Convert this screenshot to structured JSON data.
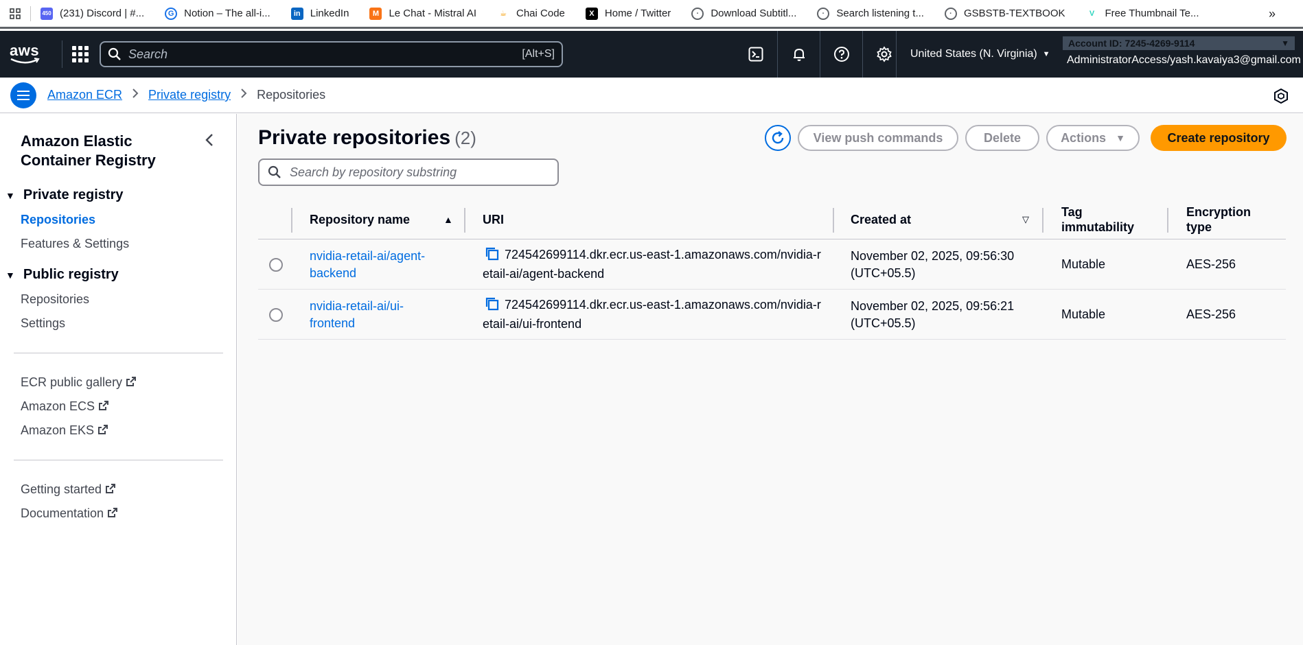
{
  "bookmarks": [
    {
      "label": "(231) Discord | #...",
      "color": "#5865f2",
      "glyph": "450"
    },
    {
      "label": "Notion – The all-i...",
      "color": "#1a73e8",
      "glyph": "G"
    },
    {
      "label": "LinkedIn",
      "color": "#0a66c2",
      "glyph": "in"
    },
    {
      "label": "Le Chat - Mistral AI",
      "color": "#f97316",
      "glyph": "M"
    },
    {
      "label": "Chai Code",
      "color": "#f59e0b",
      "glyph": "☕"
    },
    {
      "label": "Home / Twitter",
      "color": "#000000",
      "glyph": "X"
    },
    {
      "label": "Download Subtitl...",
      "color": "#5f6368",
      "glyph": "◎"
    },
    {
      "label": "Search listening t...",
      "color": "#5f6368",
      "glyph": "◎"
    },
    {
      "label": "GSBSTB-TEXTBOOK",
      "color": "#5f6368",
      "glyph": "◎"
    },
    {
      "label": "Free Thumbnail Te...",
      "color": "#2dd4bf",
      "glyph": "V"
    }
  ],
  "bookmarks_more": "»",
  "topnav": {
    "logo": "aws",
    "search_placeholder": "Search",
    "search_shortcut": "[Alt+S]",
    "region": "United States (N. Virginia)",
    "account_id": "Account ID: 7245-4269-9114",
    "account_user": "AdministratorAccess/yash.kavaiya3@gmail.com"
  },
  "breadcrumb": {
    "items": [
      "Amazon ECR",
      "Private registry"
    ],
    "current": "Repositories"
  },
  "sidebar": {
    "title": "Amazon Elastic Container Registry",
    "sections": [
      {
        "label": "Private registry",
        "items": [
          "Repositories",
          "Features & Settings"
        ]
      },
      {
        "label": "Public registry",
        "items": [
          "Repositories",
          "Settings"
        ]
      }
    ],
    "external_links": [
      "ECR public gallery",
      "Amazon ECS",
      "Amazon EKS"
    ],
    "help_links": [
      "Getting started",
      "Documentation"
    ]
  },
  "main": {
    "title": "Private repositories",
    "count": "(2)",
    "buttons": {
      "view_push": "View push commands",
      "delete": "Delete",
      "actions": "Actions",
      "create": "Create repository"
    },
    "search_placeholder": "Search by repository substring",
    "columns": [
      "Repository name",
      "URI",
      "Created at",
      "Tag immutability",
      "Encryption type"
    ],
    "rows": [
      {
        "name": "nvidia-retail-ai/agent-backend",
        "uri": "724542699114.dkr.ecr.us-east-1.amazonaws.com/nvidia-retail-ai/agent-backend",
        "created": "November 02, 2025, 09:56:30 (UTC+05.5)",
        "immutability": "Mutable",
        "encryption": "AES-256"
      },
      {
        "name": "nvidia-retail-ai/ui-frontend",
        "uri": "724542699114.dkr.ecr.us-east-1.amazonaws.com/nvidia-retail-ai/ui-frontend",
        "created": "November 02, 2025, 09:56:21 (UTC+05.5)",
        "immutability": "Mutable",
        "encryption": "AES-256"
      }
    ]
  },
  "colors": {
    "nav_bg": "#161d26",
    "link": "#006ce0",
    "primary_button": "#ff9900"
  }
}
